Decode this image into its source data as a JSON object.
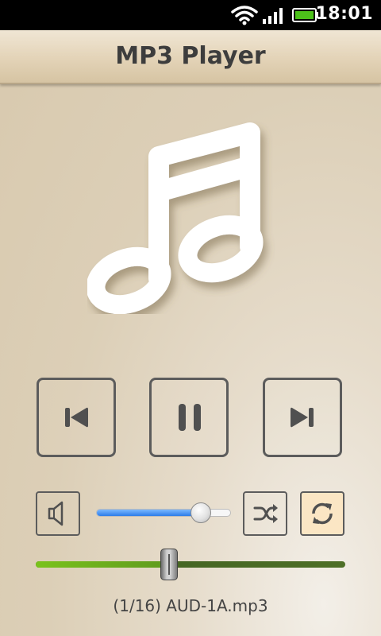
{
  "status_bar": {
    "time": "18:01",
    "icons": [
      "wifi-icon",
      "signal-icon",
      "battery-icon"
    ],
    "battery_color": "#4cc21a"
  },
  "app": {
    "title": "MP3 Player"
  },
  "album_art": {
    "icon": "music-note-icon"
  },
  "controls": {
    "transport": [
      {
        "name": "previous-button",
        "icon": "skip-previous-icon"
      },
      {
        "name": "pause-button",
        "icon": "pause-icon"
      },
      {
        "name": "next-button",
        "icon": "skip-next-icon"
      }
    ],
    "volume": {
      "icon": "speaker-icon",
      "level": 0.78,
      "accent": "#2b7ce9"
    },
    "shuffle": {
      "icon": "shuffle-icon",
      "active": false
    },
    "repeat": {
      "icon": "repeat-icon",
      "active": true,
      "highlight": "#fbe6c4"
    }
  },
  "playback": {
    "progress": 0.43,
    "accent": "#7ac21c"
  },
  "track": {
    "label": "(1/16) AUD-1A.mp3"
  }
}
